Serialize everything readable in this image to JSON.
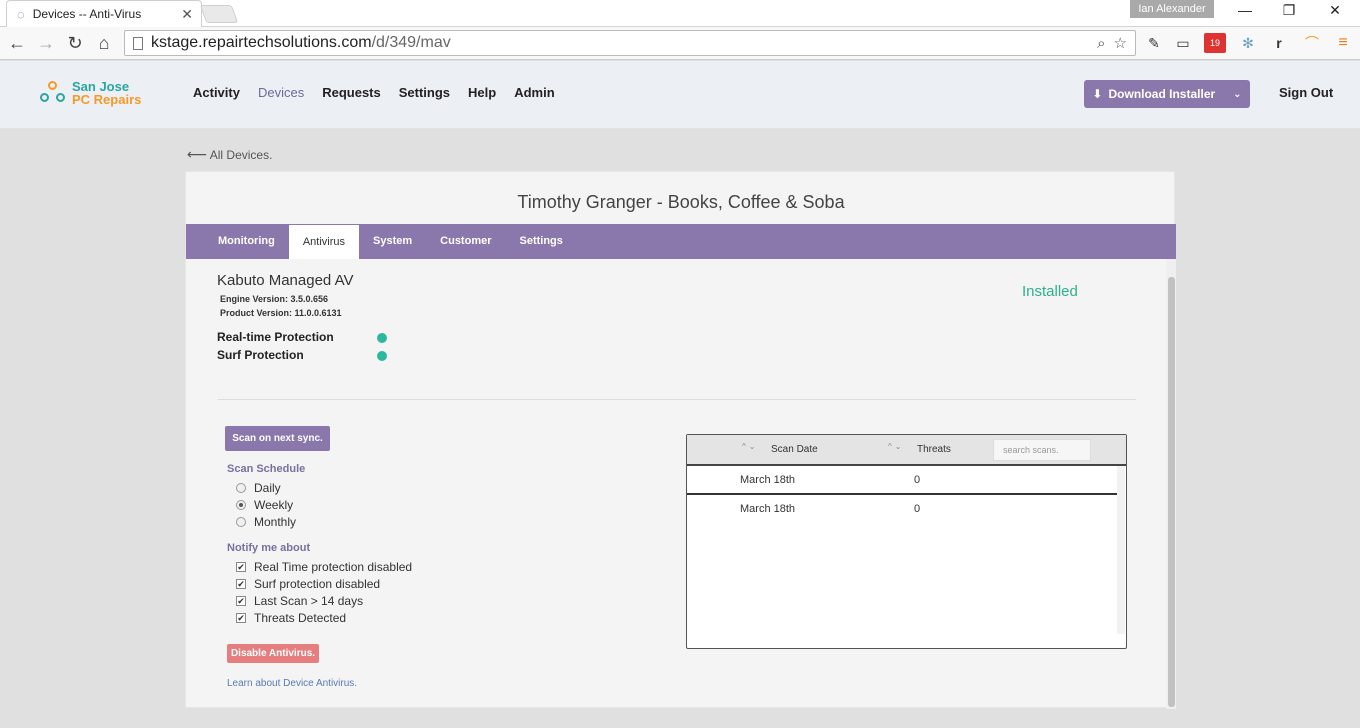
{
  "browser": {
    "tab_title": "Devices -- Anti-Virus",
    "profile_name": "Ian Alexander",
    "url_host": "kstage.repairtechsolutions.com",
    "url_path": "/d/349/mav",
    "ext_badge": "19"
  },
  "header": {
    "logo_line1": "San Jose",
    "logo_line2": "PC Repairs",
    "nav": [
      "Activity",
      "Devices",
      "Requests",
      "Settings",
      "Help",
      "Admin"
    ],
    "active_nav": "Devices",
    "download_label": "Download Installer",
    "signout_label": "Sign Out"
  },
  "back_link": "All Devices.",
  "device": {
    "title": "Timothy Granger - Books, Coffee & Soba",
    "tabs": [
      "Monitoring",
      "Antivirus",
      "System",
      "Customer",
      "Settings"
    ],
    "active_tab": "Antivirus"
  },
  "antivirus": {
    "name": "Kabuto Managed AV",
    "engine_version": "Engine Version: 3.5.0.656",
    "product_version": "Product Version: 11.0.0.6131",
    "status": "Installed",
    "realtime_label": "Real-time Protection",
    "surf_label": "Surf Protection",
    "status_color": "#2ab99c",
    "scan_button": "Scan on next sync.",
    "schedule_label": "Scan Schedule",
    "schedule_options": [
      "Daily",
      "Weekly",
      "Monthly"
    ],
    "schedule_selected": "Weekly",
    "notify_label": "Notify me about",
    "notify_options": [
      "Real Time protection disabled",
      "Surf protection disabled",
      "Last Scan > 14 days",
      "Threats Detected"
    ],
    "disable_button": "Disable Antivirus.",
    "learn_link": "Learn about Device Antivirus."
  },
  "scans": {
    "col_date": "Scan Date",
    "col_threats": "Threats",
    "search_placeholder": "search scans.",
    "rows": [
      {
        "date": "March 18th",
        "threats": "0"
      },
      {
        "date": "March 18th",
        "threats": "0"
      }
    ]
  }
}
